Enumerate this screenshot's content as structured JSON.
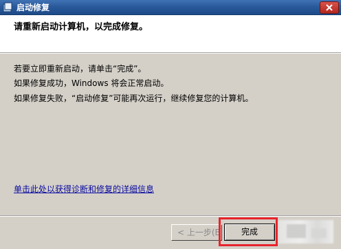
{
  "window": {
    "title": "启动修复",
    "close_icon": "close-icon"
  },
  "header": {
    "title": "请重新启动计算机，以完成修复。"
  },
  "content": {
    "lines": [
      "若要立即重新启动，请单击“完成”。",
      "如果修复成功，Windows 将会正常启动。",
      "如果修复失败，“启动修复”可能再次运行，继续修复您的计算机。"
    ],
    "details_link": "单击此处以获得诊断和修复的详细信息"
  },
  "buttons": {
    "back": "< 上一步(B)",
    "finish": "完成"
  },
  "colors": {
    "titlebar": "#2a5a9c",
    "link": "#0a0aa0",
    "highlight": "#e8232c"
  }
}
